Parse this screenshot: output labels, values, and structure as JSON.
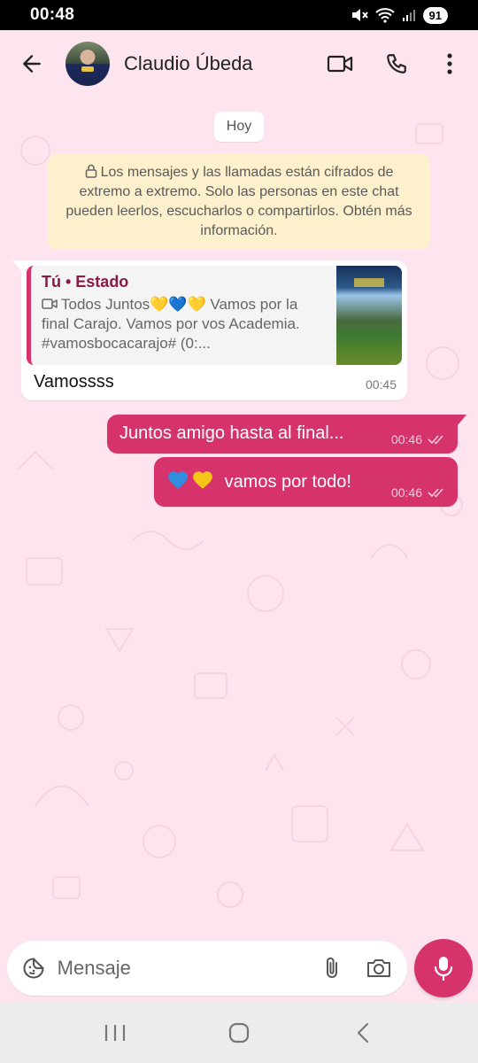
{
  "status_bar": {
    "time": "00:48",
    "battery": "91"
  },
  "header": {
    "contact_name": "Claudio Úbeda"
  },
  "chat": {
    "date_label": "Hoy",
    "encryption_notice": "Los mensajes y las llamadas están cifrados de extremo a extremo. Solo las personas en este chat pueden leerlos, escucharlos o compartirlos. Obtén más información.",
    "messages": [
      {
        "direction": "incoming",
        "quote_title": "Tú • Estado",
        "quote_body": "Todos Juntos💛💙💛 Vamos por la final Carajo. Vamos por vos Academia. #vamosbocacarajo# (0:...",
        "text": "Vamossss",
        "time": "00:45"
      },
      {
        "direction": "outgoing",
        "text": "Juntos amigo hasta al final...",
        "time": "00:46",
        "status": "read"
      },
      {
        "direction": "outgoing",
        "text": "vamos por todo!",
        "time": "00:46",
        "status": "read"
      }
    ]
  },
  "input": {
    "placeholder": "Mensaje"
  },
  "colors": {
    "accent": "#d6336c",
    "background": "#fde4ee",
    "quote_title": "#8a1a45"
  },
  "icons": [
    "back-arrow-icon",
    "video-call-icon",
    "phone-icon",
    "more-options-icon",
    "lock-icon",
    "video-icon",
    "double-check-icon",
    "sticker-icon",
    "attach-icon",
    "camera-icon",
    "mic-icon",
    "recent-apps-icon",
    "home-icon",
    "back-nav-icon"
  ]
}
